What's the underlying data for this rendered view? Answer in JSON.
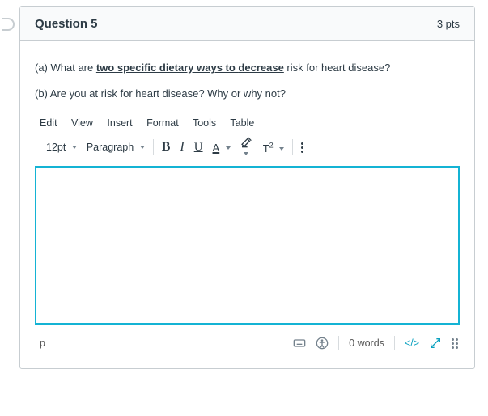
{
  "header": {
    "title": "Question 5",
    "points": "3 pts"
  },
  "prompts": {
    "a_prefix": "(a) What are ",
    "a_bold_ul": "two specific dietary ways to ",
    "a_decrease": "decrease",
    "a_suffix": " risk for heart disease?",
    "b": "(b) Are you at risk for heart disease? Why or why not?"
  },
  "menus": {
    "edit": "Edit",
    "view": "View",
    "insert": "Insert",
    "format": "Format",
    "tools": "Tools",
    "table": "Table"
  },
  "toolbar": {
    "font_size": "12pt",
    "block": "Paragraph",
    "bold": "B",
    "italic": "I",
    "underline": "U",
    "textcolor": "A",
    "super": "T",
    "super_exp": "2"
  },
  "status": {
    "path": "p",
    "word_count": "0 words",
    "html": "</>"
  }
}
